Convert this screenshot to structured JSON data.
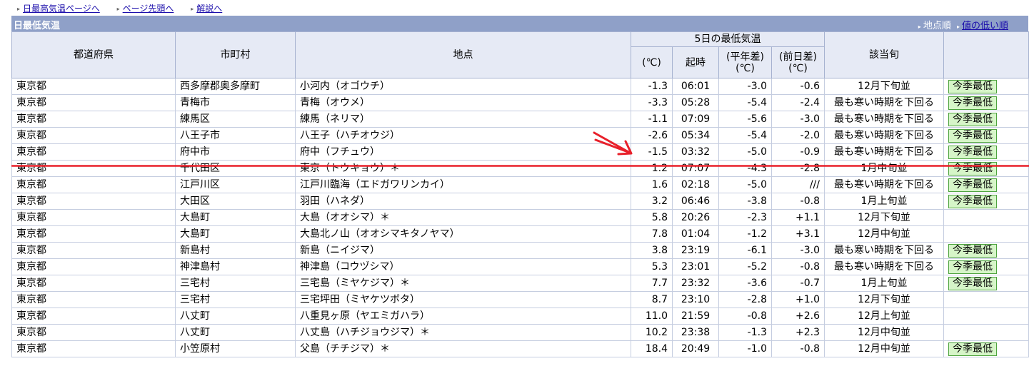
{
  "nav": {
    "links": [
      "日最高気温ページへ",
      "ページ先頭へ",
      "解説へ"
    ]
  },
  "title": "日最低気温",
  "sort": {
    "current": "地点順",
    "link": "値の低い順"
  },
  "headers": {
    "pref": "都道府県",
    "city": "市町村",
    "station": "地点",
    "group": "5日の最低気温",
    "temp": "(℃)",
    "time": "起時",
    "normal_diff": "(平年差)(℃)",
    "prev_diff": "(前日差)(℃)",
    "period": "該当旬",
    "record": ""
  },
  "colors": {
    "header_bar": "#8fa0c8",
    "badge_bg": "#d6f5c8",
    "annotation": "#e8202a"
  },
  "badge_label": "今季最低",
  "rows": [
    {
      "pref": "東京都",
      "city": "西多摩郡奥多摩町",
      "station": "小河内（オゴウチ）",
      "temp": "-1.3",
      "time": "06:01",
      "normal": "-3.0",
      "prev": "-0.6",
      "period": "12月下旬並",
      "record": "今季最低"
    },
    {
      "pref": "東京都",
      "city": "青梅市",
      "station": "青梅（オウメ）",
      "temp": "-3.3",
      "time": "05:28",
      "normal": "-5.4",
      "prev": "-2.4",
      "period": "最も寒い時期を下回る",
      "record": "今季最低"
    },
    {
      "pref": "東京都",
      "city": "練馬区",
      "station": "練馬（ネリマ）",
      "temp": "-1.1",
      "time": "07:09",
      "normal": "-5.6",
      "prev": "-3.0",
      "period": "最も寒い時期を下回る",
      "record": "今季最低"
    },
    {
      "pref": "東京都",
      "city": "八王子市",
      "station": "八王子（ハチオウジ）",
      "temp": "-2.6",
      "time": "05:34",
      "normal": "-5.4",
      "prev": "-2.0",
      "period": "最も寒い時期を下回る",
      "record": "今季最低"
    },
    {
      "pref": "東京都",
      "city": "府中市",
      "station": "府中（フチュウ）",
      "temp": "-1.5",
      "time": "03:32",
      "normal": "-5.0",
      "prev": "-0.9",
      "period": "最も寒い時期を下回る",
      "record": "今季最低"
    },
    {
      "pref": "東京都",
      "city": "千代田区",
      "station": "東京（トウキョウ）＊",
      "temp": "1.2",
      "time": "07:07",
      "normal": "-4.3",
      "prev": "-2.8",
      "period": "1月中旬並",
      "record": "今季最低"
    },
    {
      "pref": "東京都",
      "city": "江戸川区",
      "station": "江戸川臨海（エドガワリンカイ）",
      "temp": "1.6",
      "time": "02:18",
      "normal": "-5.0",
      "prev": "///",
      "period": "最も寒い時期を下回る",
      "record": "今季最低"
    },
    {
      "pref": "東京都",
      "city": "大田区",
      "station": "羽田（ハネダ）",
      "temp": "3.2",
      "time": "06:46",
      "normal": "-3.8",
      "prev": "-0.8",
      "period": "1月上旬並",
      "record": "今季最低"
    },
    {
      "pref": "東京都",
      "city": "大島町",
      "station": "大島（オオシマ）＊",
      "temp": "5.8",
      "time": "20:26",
      "normal": "-2.3",
      "prev": "+1.1",
      "period": "12月下旬並",
      "record": ""
    },
    {
      "pref": "東京都",
      "city": "大島町",
      "station": "大島北ノ山（オオシマキタノヤマ）",
      "temp": "7.8",
      "time": "01:04",
      "normal": "-1.2",
      "prev": "+3.1",
      "period": "12月中旬並",
      "record": ""
    },
    {
      "pref": "東京都",
      "city": "新島村",
      "station": "新島（ニイジマ）",
      "temp": "3.8",
      "time": "23:19",
      "normal": "-6.1",
      "prev": "-3.0",
      "period": "最も寒い時期を下回る",
      "record": "今季最低"
    },
    {
      "pref": "東京都",
      "city": "神津島村",
      "station": "神津島（コウヅシマ）",
      "temp": "5.3",
      "time": "23:01",
      "normal": "-5.2",
      "prev": "-0.8",
      "period": "最も寒い時期を下回る",
      "record": "今季最低"
    },
    {
      "pref": "東京都",
      "city": "三宅村",
      "station": "三宅島（ミヤケジマ）＊",
      "temp": "7.7",
      "time": "23:32",
      "normal": "-3.6",
      "prev": "-0.7",
      "period": "1月上旬並",
      "record": "今季最低"
    },
    {
      "pref": "東京都",
      "city": "三宅村",
      "station": "三宅坪田（ミヤケツボタ）",
      "temp": "8.7",
      "time": "23:10",
      "normal": "-2.8",
      "prev": "+1.0",
      "period": "12月下旬並",
      "record": ""
    },
    {
      "pref": "東京都",
      "city": "八丈町",
      "station": "八重見ヶ原（ヤエミガハラ）",
      "temp": "11.0",
      "time": "21:59",
      "normal": "-0.8",
      "prev": "+2.6",
      "period": "12月上旬並",
      "record": ""
    },
    {
      "pref": "東京都",
      "city": "八丈町",
      "station": "八丈島（ハチジョウジマ）＊",
      "temp": "10.2",
      "time": "23:38",
      "normal": "-1.3",
      "prev": "+2.3",
      "period": "12月中旬並",
      "record": ""
    },
    {
      "pref": "東京都",
      "city": "小笠原村",
      "station": "父島（チチジマ）＊",
      "temp": "18.4",
      "time": "20:49",
      "normal": "-1.0",
      "prev": "-0.8",
      "period": "12月中旬並",
      "record": "今季最低"
    }
  ]
}
